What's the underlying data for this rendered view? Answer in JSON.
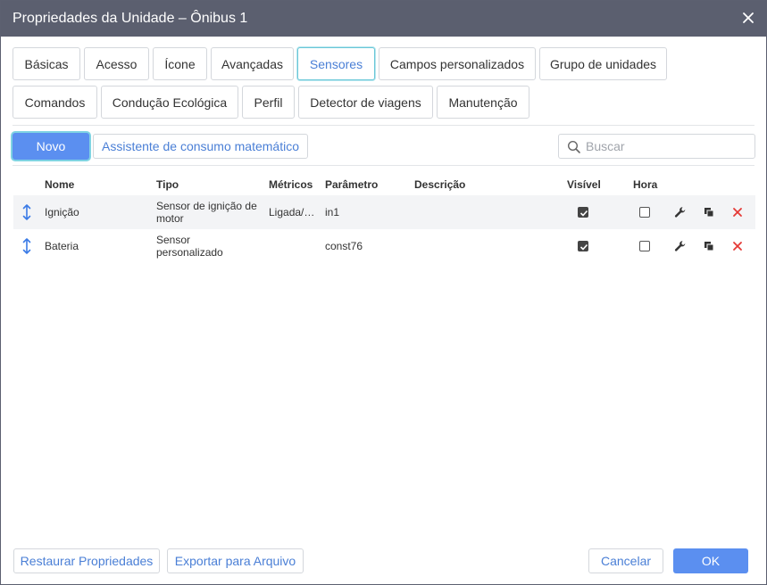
{
  "window": {
    "title": "Propriedades da Unidade – Ônibus 1"
  },
  "tabs": [
    {
      "label": "Básicas"
    },
    {
      "label": "Acesso"
    },
    {
      "label": "Ícone"
    },
    {
      "label": "Avançadas"
    },
    {
      "label": "Sensores",
      "active": true
    },
    {
      "label": "Campos personalizados"
    },
    {
      "label": "Grupo de unidades"
    },
    {
      "label": "Comandos"
    },
    {
      "label": "Condução Ecológica"
    },
    {
      "label": "Perfil"
    },
    {
      "label": "Detector de viagens"
    },
    {
      "label": "Manutenção"
    }
  ],
  "toolbar": {
    "new_label": "Novo",
    "wizard_label": "Assistente de consumo matemático",
    "search_placeholder": "Buscar"
  },
  "table": {
    "headers": {
      "name": "Nome",
      "type": "Tipo",
      "metrics": "Métricos",
      "parameter": "Parâmetro",
      "description": "Descrição",
      "visible": "Visível",
      "time": "Hora"
    },
    "rows": [
      {
        "name": "Ignição",
        "type_line1": "Sensor de ignição de",
        "type_line2": "motor",
        "metrics": "Ligada/…",
        "parameter": "in1",
        "description": "",
        "visible": true,
        "time": false
      },
      {
        "name": "Bateria",
        "type_line1": "Sensor",
        "type_line2": "personalizado",
        "metrics": "",
        "parameter": "const76",
        "description": "",
        "visible": true,
        "time": false
      }
    ]
  },
  "footer": {
    "restore_label": "Restaurar Propriedades",
    "export_label": "Exportar para Arquivo",
    "cancel_label": "Cancelar",
    "ok_label": "OK"
  },
  "colors": {
    "titlebar": "#5b5f6f",
    "accent": "#5b8ff0",
    "link": "#4a7fd6",
    "active_tab_border": "#69c7d8",
    "delete": "#e53935"
  },
  "icons": {
    "close": "close-icon",
    "search": "search-icon",
    "drag": "drag-handle-icon",
    "edit": "wrench-icon",
    "copy": "copy-icon",
    "delete": "delete-icon"
  }
}
